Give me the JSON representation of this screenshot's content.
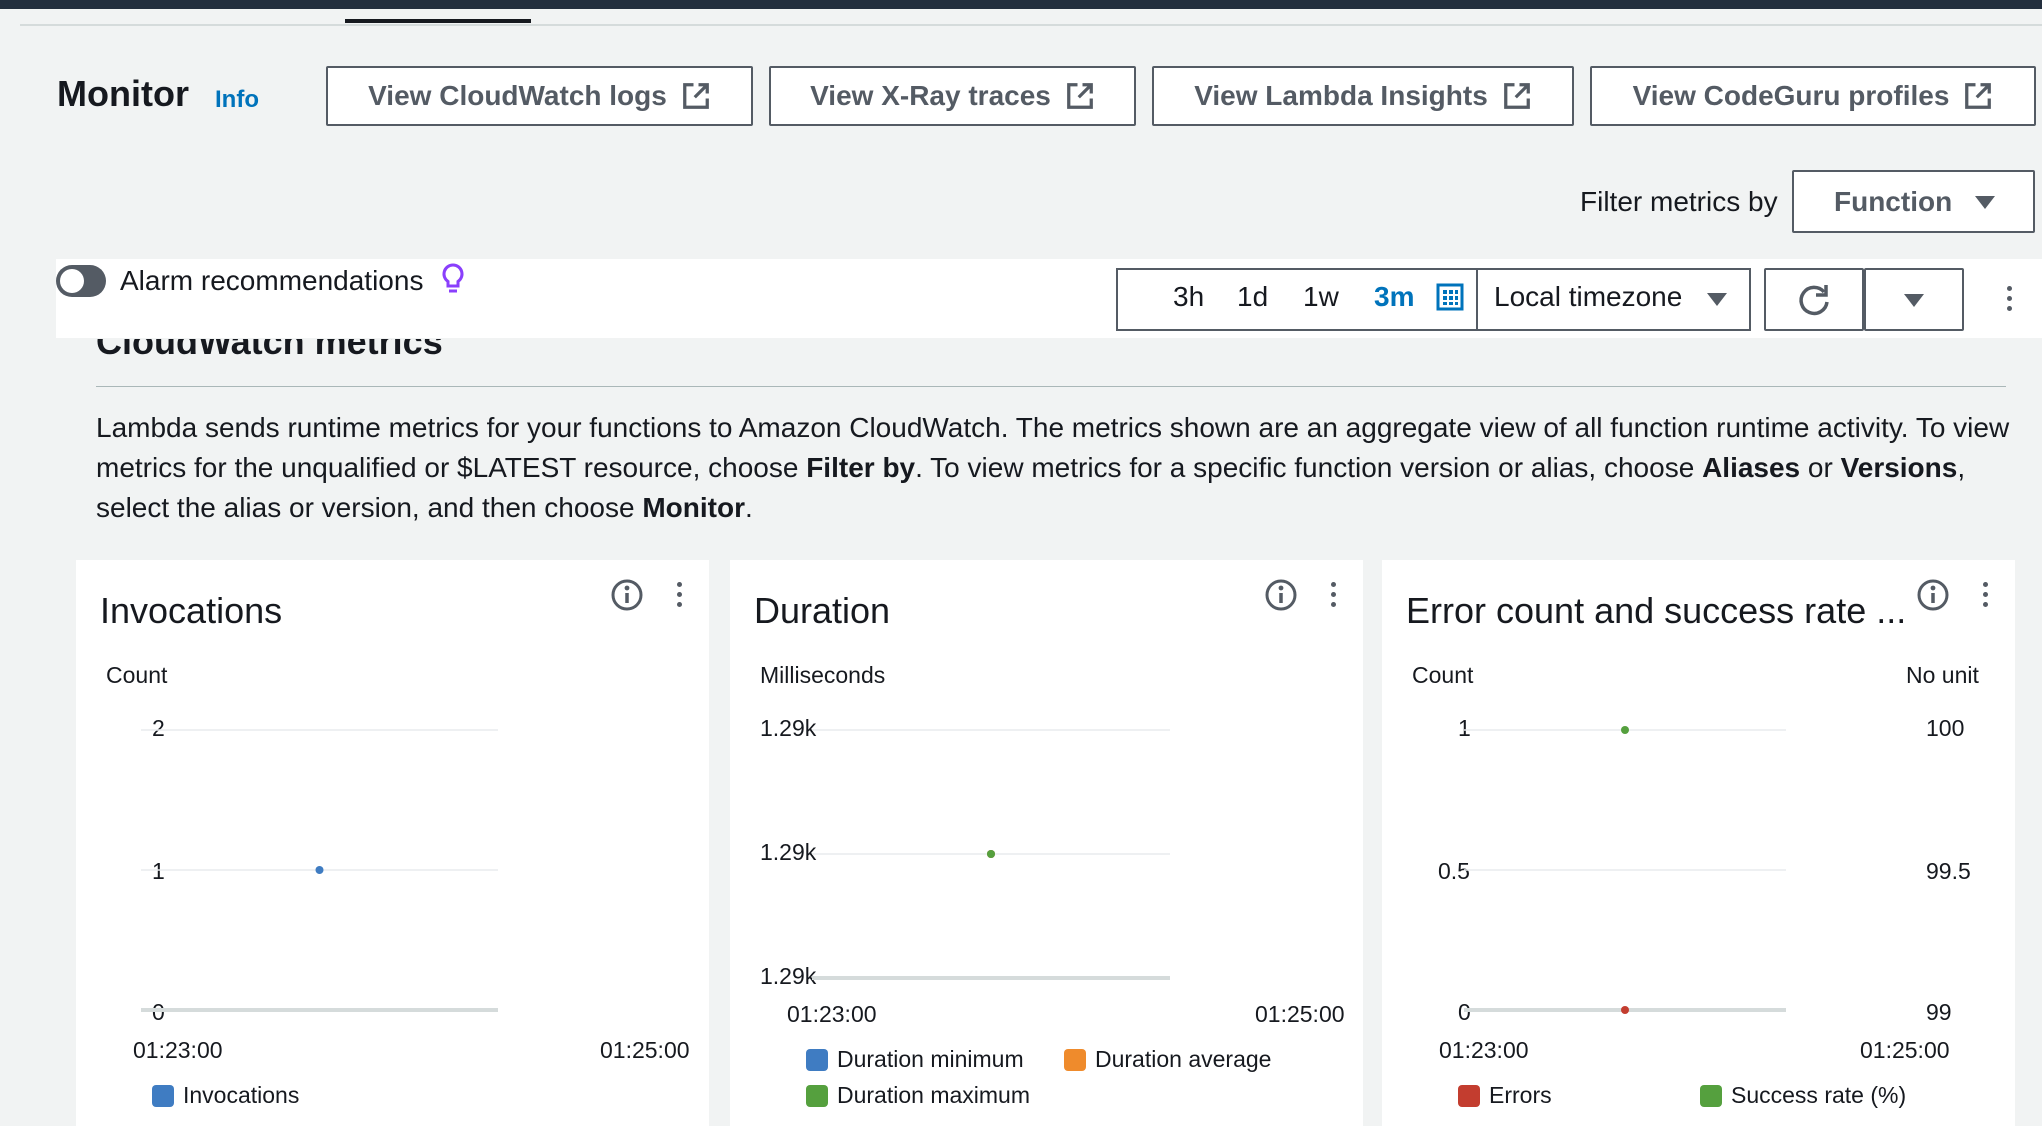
{
  "header": {
    "title": "Monitor",
    "info": "Info"
  },
  "actions": [
    {
      "label": "View CloudWatch logs",
      "icon": "external-link-icon"
    },
    {
      "label": "View X-Ray traces",
      "icon": "external-link-icon"
    },
    {
      "label": "View Lambda Insights",
      "icon": "external-link-icon"
    },
    {
      "label": "View CodeGuru profiles",
      "icon": "external-link-icon"
    }
  ],
  "filter": {
    "label": "Filter metrics by",
    "value": "Function"
  },
  "alarm": {
    "label": "Alarm recommendations",
    "enabled": false
  },
  "time_range": {
    "options": [
      "3h",
      "1d",
      "1w",
      "3m"
    ],
    "selected": "3m",
    "timezone": "Local timezone"
  },
  "section": {
    "title": "CloudWatch metrics",
    "desc_1": "Lambda sends runtime metrics for your functions to Amazon CloudWatch. The metrics shown are an aggregate view of all function runtime activity. To view metrics for the unqualified or $LATEST resource, choose ",
    "desc_b1": "Filter by",
    "desc_2": ". To view metrics for a specific function version or alias, choose ",
    "desc_b2": "Aliases",
    "desc_3": " or ",
    "desc_b3": "Versions",
    "desc_4": ", select the alias or version, and then choose ",
    "desc_b4": "Monitor",
    "desc_5": "."
  },
  "colors": {
    "blue": "#3f7cc2",
    "orange": "#ef8b2c",
    "green": "#55a03e",
    "red": "#c33d2f"
  },
  "cards": [
    {
      "title": "Invocations",
      "unit_left": "Count",
      "y_ticks": [
        "2",
        "1",
        "0"
      ],
      "x_ticks": [
        "01:23:00",
        "01:25:00"
      ],
      "legend": [
        {
          "label": "Invocations",
          "color": "#3f7cc2"
        }
      ]
    },
    {
      "title": "Duration",
      "unit_left": "Milliseconds",
      "y_ticks": [
        "1.29k",
        "1.29k",
        "1.29k"
      ],
      "x_ticks": [
        "01:23:00",
        "01:25:00"
      ],
      "legend": [
        {
          "label": "Duration minimum",
          "color": "#3f7cc2"
        },
        {
          "label": "Duration average",
          "color": "#ef8b2c"
        },
        {
          "label": "Duration maximum",
          "color": "#55a03e"
        }
      ]
    },
    {
      "title": "Error count and success rate ...",
      "unit_left": "Count",
      "unit_right": "No unit",
      "y_ticks": [
        "1",
        "0.5",
        "0"
      ],
      "y_ticks_right": [
        "100",
        "99.5",
        "99"
      ],
      "x_ticks": [
        "01:23:00",
        "01:25:00"
      ],
      "legend": [
        {
          "label": "Errors",
          "color": "#c33d2f"
        },
        {
          "label": "Success rate (%)",
          "color": "#55a03e"
        }
      ]
    }
  ],
  "chart_data": [
    {
      "type": "scatter",
      "title": "Invocations",
      "ylabel": "Count",
      "x_range": [
        "01:23:00",
        "01:25:00"
      ],
      "ylim": [
        0,
        2
      ],
      "series": [
        {
          "name": "Invocations",
          "x": [
            "01:24:00"
          ],
          "values": [
            1
          ]
        }
      ]
    },
    {
      "type": "scatter",
      "title": "Duration",
      "ylabel": "Milliseconds",
      "x_range": [
        "01:23:00",
        "01:25:00"
      ],
      "series": [
        {
          "name": "Duration minimum",
          "x": [
            "01:24:00"
          ],
          "values": [
            1290
          ]
        },
        {
          "name": "Duration average",
          "x": [
            "01:24:00"
          ],
          "values": [
            1290
          ]
        },
        {
          "name": "Duration maximum",
          "x": [
            "01:24:00"
          ],
          "values": [
            1290
          ]
        }
      ]
    },
    {
      "type": "scatter",
      "title": "Error count and success rate ...",
      "ylabel": "Count",
      "y2label": "No unit",
      "x_range": [
        "01:23:00",
        "01:25:00"
      ],
      "ylim": [
        0,
        1
      ],
      "y2lim": [
        99,
        100
      ],
      "series": [
        {
          "name": "Errors",
          "axis": "left",
          "x": [
            "01:24:00"
          ],
          "values": [
            0
          ]
        },
        {
          "name": "Success rate (%)",
          "axis": "right",
          "x": [
            "01:24:00"
          ],
          "values": [
            100
          ]
        }
      ]
    }
  ]
}
